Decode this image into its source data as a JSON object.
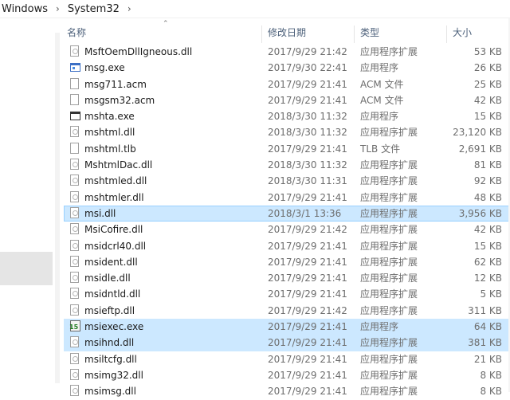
{
  "breadcrumb": {
    "items": [
      "Windows",
      "System32"
    ],
    "separator": "›"
  },
  "columns": {
    "name": "名称",
    "date": "修改日期",
    "type": "类型",
    "size": "大小"
  },
  "files": [
    {
      "name": "MsftOemDllIgneous.dll",
      "date": "2017/9/29 21:42",
      "type": "应用程序扩展",
      "size": "53 KB",
      "icon": "dll-file-icon",
      "state": ""
    },
    {
      "name": "msg.exe",
      "date": "2017/9/30 22:41",
      "type": "应用程序",
      "size": "26 KB",
      "icon": "exe-file-icon",
      "state": ""
    },
    {
      "name": "msg711.acm",
      "date": "2017/9/29 21:41",
      "type": "ACM 文件",
      "size": "25 KB",
      "icon": "document-file-icon",
      "state": ""
    },
    {
      "name": "msgsm32.acm",
      "date": "2017/9/29 21:41",
      "type": "ACM 文件",
      "size": "42 KB",
      "icon": "document-file-icon",
      "state": ""
    },
    {
      "name": "mshta.exe",
      "date": "2018/3/30 11:32",
      "type": "应用程序",
      "size": "15 KB",
      "icon": "hta-exe-icon",
      "state": ""
    },
    {
      "name": "mshtml.dll",
      "date": "2018/3/30 11:32",
      "type": "应用程序扩展",
      "size": "23,120 KB",
      "icon": "dll-file-icon",
      "state": ""
    },
    {
      "name": "mshtml.tlb",
      "date": "2017/9/29 21:41",
      "type": "TLB 文件",
      "size": "2,691 KB",
      "icon": "document-file-icon",
      "state": ""
    },
    {
      "name": "MshtmlDac.dll",
      "date": "2018/3/30 11:32",
      "type": "应用程序扩展",
      "size": "81 KB",
      "icon": "dll-file-icon",
      "state": ""
    },
    {
      "name": "mshtmled.dll",
      "date": "2018/3/30 11:31",
      "type": "应用程序扩展",
      "size": "92 KB",
      "icon": "dll-file-icon",
      "state": ""
    },
    {
      "name": "mshtmler.dll",
      "date": "2017/9/29 21:41",
      "type": "应用程序扩展",
      "size": "48 KB",
      "icon": "dll-file-icon",
      "state": ""
    },
    {
      "name": "msi.dll",
      "date": "2018/3/1 13:36",
      "type": "应用程序扩展",
      "size": "3,956 KB",
      "icon": "dll-file-icon",
      "state": "selected-focus"
    },
    {
      "name": "MsiCofire.dll",
      "date": "2017/9/29 21:42",
      "type": "应用程序扩展",
      "size": "42 KB",
      "icon": "dll-file-icon",
      "state": ""
    },
    {
      "name": "msidcrl40.dll",
      "date": "2017/9/29 21:41",
      "type": "应用程序扩展",
      "size": "15 KB",
      "icon": "dll-file-icon",
      "state": ""
    },
    {
      "name": "msident.dll",
      "date": "2017/9/29 21:41",
      "type": "应用程序扩展",
      "size": "62 KB",
      "icon": "dll-file-icon",
      "state": ""
    },
    {
      "name": "msidle.dll",
      "date": "2017/9/29 21:41",
      "type": "应用程序扩展",
      "size": "12 KB",
      "icon": "dll-file-icon",
      "state": ""
    },
    {
      "name": "msidntld.dll",
      "date": "2017/9/29 21:41",
      "type": "应用程序扩展",
      "size": "5 KB",
      "icon": "dll-file-icon",
      "state": ""
    },
    {
      "name": "msieftp.dll",
      "date": "2017/9/29 21:42",
      "type": "应用程序扩展",
      "size": "311 KB",
      "icon": "dll-file-icon",
      "state": ""
    },
    {
      "name": "msiexec.exe",
      "date": "2017/9/29 21:41",
      "type": "应用程序",
      "size": "64 KB",
      "icon": "msi-installer-icon",
      "state": "selected"
    },
    {
      "name": "msihnd.dll",
      "date": "2017/9/29 21:41",
      "type": "应用程序扩展",
      "size": "381 KB",
      "icon": "dll-file-icon",
      "state": "selected"
    },
    {
      "name": "msiltcfg.dll",
      "date": "2017/9/29 21:41",
      "type": "应用程序扩展",
      "size": "21 KB",
      "icon": "dll-file-icon",
      "state": ""
    },
    {
      "name": "msimg32.dll",
      "date": "2017/9/29 21:41",
      "type": "应用程序扩展",
      "size": "8 KB",
      "icon": "dll-file-icon",
      "state": ""
    },
    {
      "name": "msimsg.dll",
      "date": "2017/9/29 21:41",
      "type": "应用程序扩展",
      "size": "8 KB",
      "icon": "dll-file-icon",
      "state": ""
    }
  ],
  "msi_icon_label": "15",
  "colors": {
    "selection": "#cce8ff",
    "selection_border": "#99d1ff",
    "header_text": "#4c607a"
  }
}
